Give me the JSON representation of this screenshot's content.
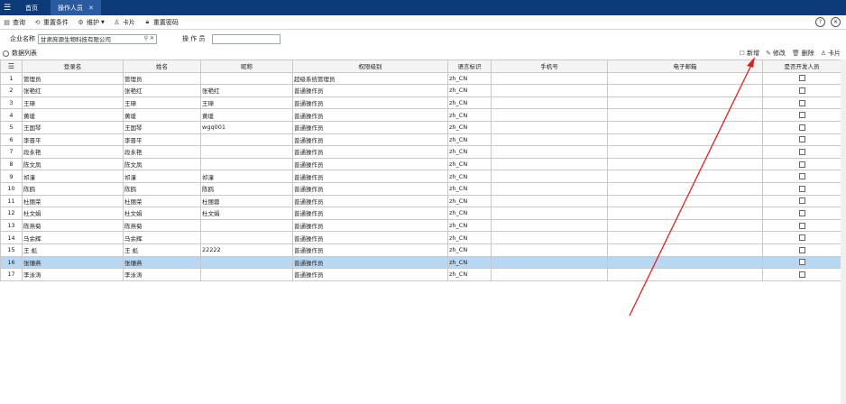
{
  "topbar": {
    "menu_icon": "hamburger-icon",
    "tabs": [
      {
        "label": "首页",
        "active": false
      },
      {
        "label": "操作人员",
        "active": true,
        "close": "✕"
      }
    ]
  },
  "toolbar": {
    "query": "查询",
    "reset": "重置条件",
    "maintain": "维护",
    "card": "卡片",
    "reset_password": "重置密码",
    "help_icon": "?",
    "close_icon": "✕"
  },
  "filter": {
    "org_label": "企业名称",
    "org_value": "甘肃庶源生物科技有限公司",
    "operator_label": "操 作 员",
    "operator_value": ""
  },
  "list": {
    "title": "数据列表",
    "actions": {
      "add": "新增",
      "edit": "修改",
      "delete": "删除",
      "card": "卡片"
    }
  },
  "table": {
    "headers": [
      "",
      "登录名",
      "姓名",
      "昵称",
      "权限级别",
      "语言标识",
      "手机号",
      "电子邮箱",
      "是否开发人员"
    ],
    "rows": [
      {
        "idx": "1",
        "login": "管理员",
        "name": "管理员",
        "nick": "",
        "level": "超级系统管理员",
        "lang": "zh_CN",
        "phone": "",
        "email": ""
      },
      {
        "idx": "2",
        "login": "张艳红",
        "name": "张艳红",
        "nick": "张艳红",
        "level": "普通操作员",
        "lang": "zh_CN",
        "phone": "",
        "email": ""
      },
      {
        "idx": "3",
        "login": "王璋",
        "name": "王璋",
        "nick": "王璋",
        "level": "普通操作员",
        "lang": "zh_CN",
        "phone": "",
        "email": ""
      },
      {
        "idx": "4",
        "login": "黄瑗",
        "name": "黄瑗",
        "nick": "黄瑗",
        "level": "普通操作员",
        "lang": "zh_CN",
        "phone": "",
        "email": ""
      },
      {
        "idx": "5",
        "login": "王国琴",
        "name": "王国琴",
        "nick": "wgq001",
        "level": "普通操作员",
        "lang": "zh_CN",
        "phone": "",
        "email": ""
      },
      {
        "idx": "6",
        "login": "李晋平",
        "name": "李晋平",
        "nick": "",
        "level": "普通操作员",
        "lang": "zh_CN",
        "phone": "",
        "email": ""
      },
      {
        "idx": "7",
        "login": "段永艳",
        "name": "段永艳",
        "nick": "",
        "level": "普通操作员",
        "lang": "zh_CN",
        "phone": "",
        "email": ""
      },
      {
        "idx": "8",
        "login": "陈文凤",
        "name": "陈文凤",
        "nick": "",
        "level": "普通操作员",
        "lang": "zh_CN",
        "phone": "",
        "email": ""
      },
      {
        "idx": "9",
        "login": "祁潼",
        "name": "祁潼",
        "nick": "祁潼",
        "level": "普通操作员",
        "lang": "zh_CN",
        "phone": "",
        "email": ""
      },
      {
        "idx": "10",
        "login": "陈鸥",
        "name": "陈鸥",
        "nick": "陈鸥",
        "level": "普通操作员",
        "lang": "zh_CN",
        "phone": "",
        "email": ""
      },
      {
        "idx": "11",
        "login": "杜丽荣",
        "name": "杜丽荣",
        "nick": "杜丽蓉",
        "level": "普通操作员",
        "lang": "zh_CN",
        "phone": "",
        "email": ""
      },
      {
        "idx": "12",
        "login": "杜文娟",
        "name": "杜文娟",
        "nick": "杜文娟",
        "level": "普通操作员",
        "lang": "zh_CN",
        "phone": "",
        "email": ""
      },
      {
        "idx": "13",
        "login": "陈燕菊",
        "name": "陈燕菊",
        "nick": "",
        "level": "普通操作员",
        "lang": "zh_CN",
        "phone": "",
        "email": ""
      },
      {
        "idx": "14",
        "login": "马余辉",
        "name": "马余辉",
        "nick": "",
        "level": "普通操作员",
        "lang": "zh_CN",
        "phone": "",
        "email": ""
      },
      {
        "idx": "15",
        "login": "王 彪",
        "name": "王 彪",
        "nick": "22222",
        "level": "普通操作员",
        "lang": "zh_CN",
        "phone": "",
        "email": ""
      },
      {
        "idx": "16",
        "login": "张珊燕",
        "name": "张珊燕",
        "nick": "",
        "level": "普通操作员",
        "lang": "zh_CN",
        "phone": "",
        "email": "",
        "selected": true
      },
      {
        "idx": "17",
        "login": "李泳涛",
        "name": "李泳涛",
        "nick": "",
        "level": "普通操作员",
        "lang": "zh_CN",
        "phone": "",
        "email": ""
      }
    ]
  },
  "colors": {
    "topbar": "#0d3a78",
    "active_tab": "#2a5aa0",
    "selected_row": "#b8d7f2",
    "annotation_arrow": "#e02020"
  }
}
